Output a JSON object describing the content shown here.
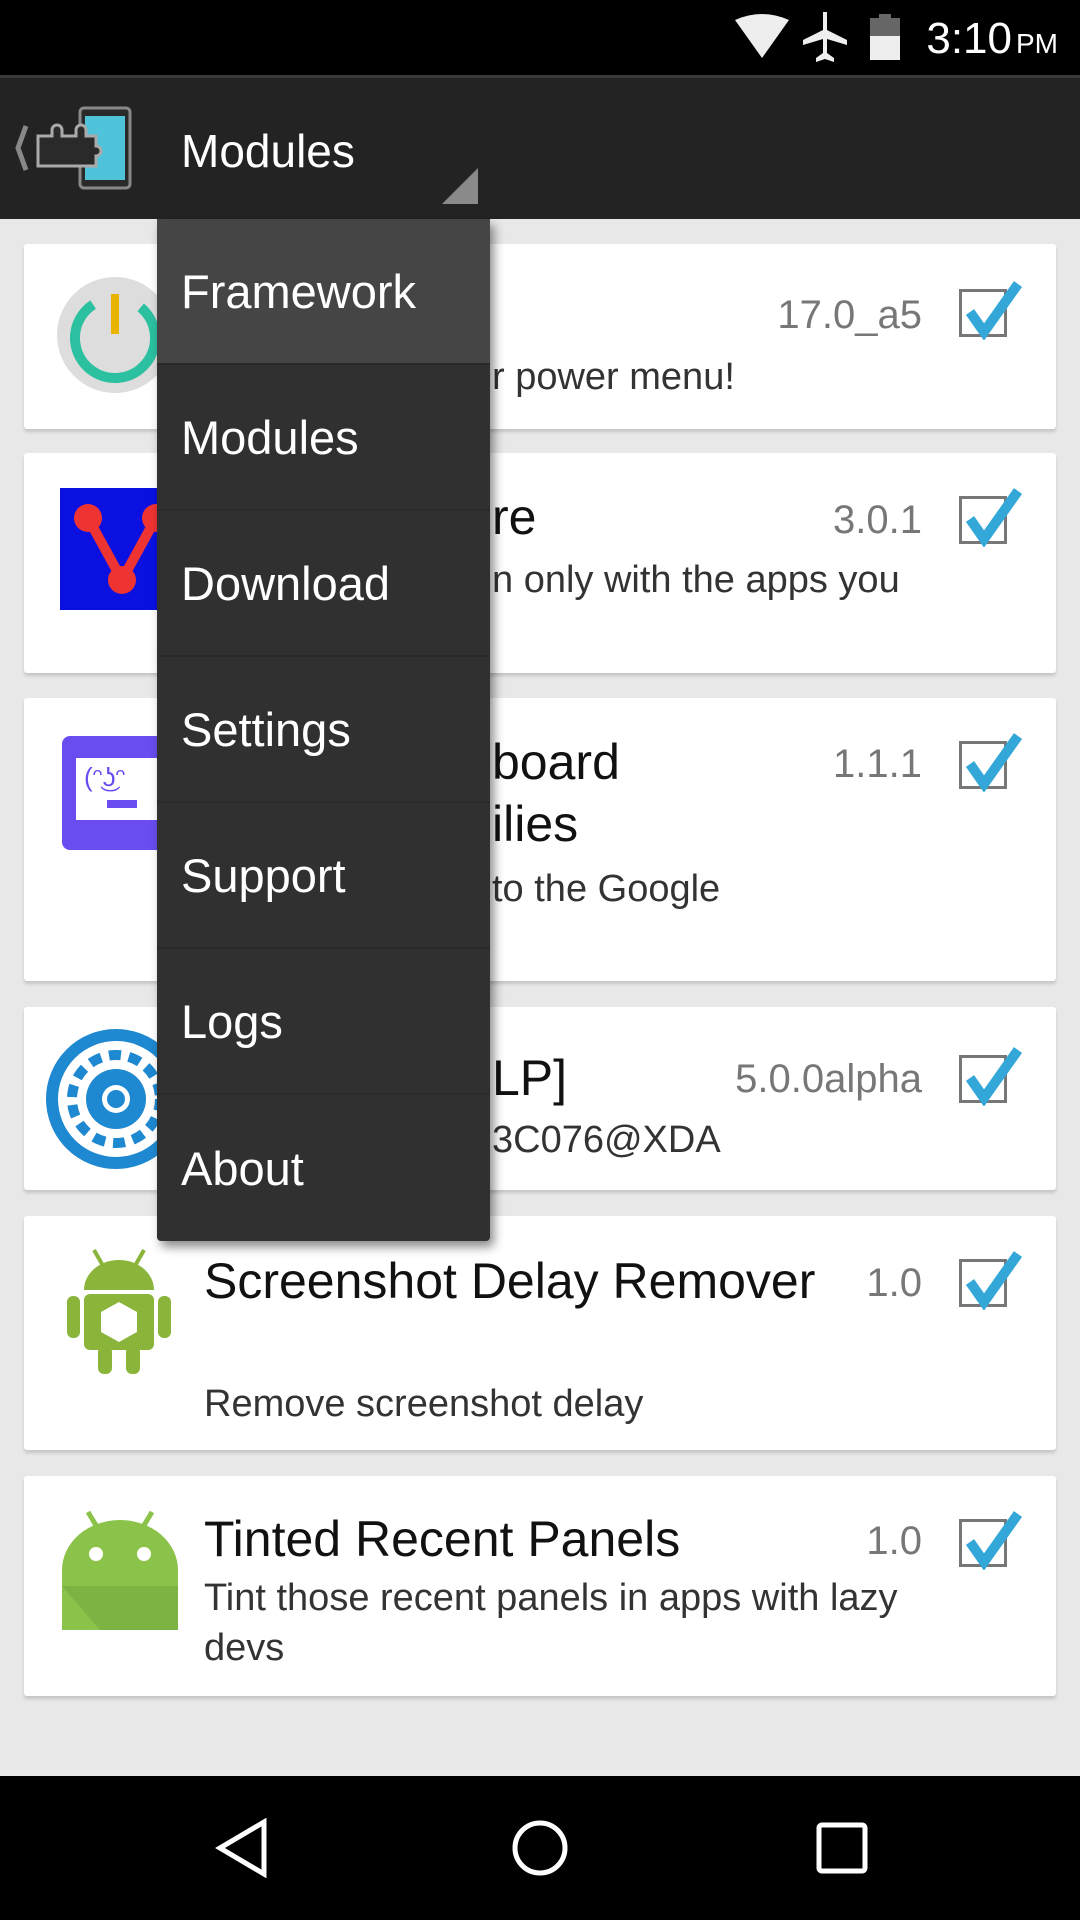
{
  "status_bar": {
    "time": "3:10",
    "ampm": "PM",
    "icons": [
      "wifi-icon",
      "airplane-icon",
      "battery-icon"
    ]
  },
  "toolbar": {
    "title": "Modules",
    "app_icon": "xposed-puzzle-icon"
  },
  "menu": {
    "items": [
      {
        "label": "Framework",
        "active": true
      },
      {
        "label": "Modules"
      },
      {
        "label": "Download"
      },
      {
        "label": "Settings"
      },
      {
        "label": "Support"
      },
      {
        "label": "Logs"
      },
      {
        "label": "About"
      }
    ]
  },
  "modules": [
    {
      "title_fragment": "",
      "desc_fragment": "r power menu!",
      "version": "17.0_a5",
      "checked": true,
      "icon": "power-icon"
    },
    {
      "title_fragment": "re",
      "desc_fragment": "n only with the apps you",
      "version": "3.0.1",
      "checked": true,
      "icon": "v-graph-icon"
    },
    {
      "title_fragment": [
        "board",
        "ilies"
      ],
      "desc_fragment": "to the Google",
      "version": "1.1.1",
      "checked": true,
      "icon": "lenny-face-icon"
    },
    {
      "title_fragment": "LP]",
      "desc_fragment": "3C076@XDA",
      "version": "5.0.0alpha",
      "checked": true,
      "icon": "gear-icon"
    },
    {
      "title": "Screenshot Delay Remover",
      "desc": "Remove screenshot delay",
      "version": "1.0",
      "checked": true,
      "icon": "android-box-icon"
    },
    {
      "title": "Tinted Recent Panels",
      "desc": "Tint those recent panels in apps with lazy devs",
      "version": "1.0",
      "checked": true,
      "icon": "android-icon"
    }
  ],
  "colors": {
    "accent": "#33b5e5",
    "toolbar": "#232323",
    "menu": "#303030"
  },
  "nav": {
    "icons": [
      "back-icon",
      "home-icon",
      "recents-icon"
    ]
  }
}
